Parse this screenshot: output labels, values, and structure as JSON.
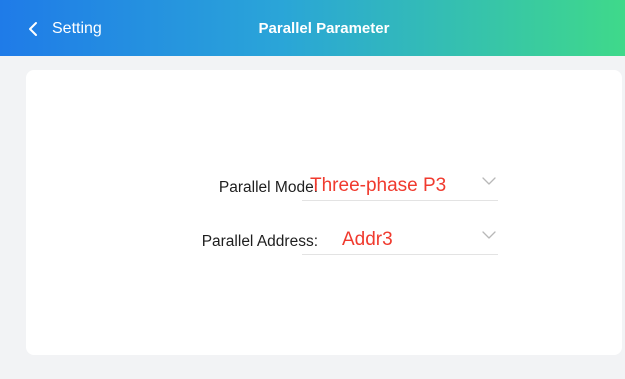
{
  "header": {
    "back_label": "Setting",
    "title": "Parallel Parameter"
  },
  "form": {
    "parallel_mode": {
      "label": "Parallel Mode:",
      "value": "Three-phase P3"
    },
    "parallel_address": {
      "label": "Parallel Address:",
      "value": "Addr3"
    }
  },
  "icons": {
    "back": "chevron-left-icon",
    "dropdown": "chevron-down-icon"
  },
  "colors": {
    "header_gradient_start": "#1f7be8",
    "header_gradient_end": "#3fd98a",
    "value_text": "#f03a2e",
    "background": "#f2f3f5",
    "card": "#ffffff"
  }
}
